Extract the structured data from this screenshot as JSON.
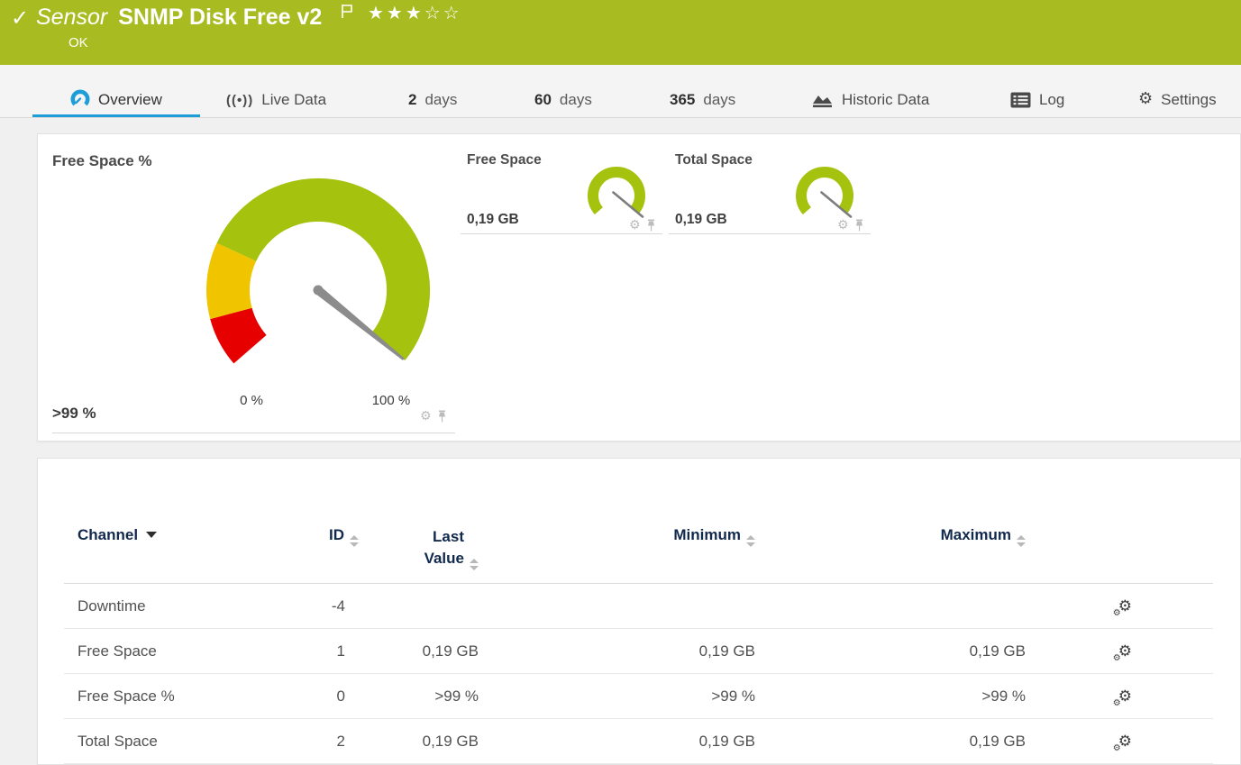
{
  "header": {
    "kind": "Sensor",
    "title": "SNMP Disk Free v2",
    "status": "OK",
    "stars_filled": "★★★",
    "stars_empty": "☆☆",
    "rating": "3 of 5",
    "bg_color": "#a8bc22"
  },
  "icons": {
    "check_glyph": "✓",
    "broadcast_glyph": "((•))",
    "gear_glyph": "⚙"
  },
  "tabs": {
    "overview": {
      "label": "Overview",
      "active": true
    },
    "live_data": {
      "label": "Live Data"
    },
    "days2": {
      "num": "2",
      "unit": "days"
    },
    "days60": {
      "num": "60",
      "unit": "days"
    },
    "days365": {
      "num": "365",
      "unit": "days"
    },
    "historic": {
      "label": "Historic Data"
    },
    "log": {
      "label": "Log"
    },
    "settings": {
      "label": "Settings"
    },
    "active_color": "#1d9ed9"
  },
  "gauges": {
    "primary": {
      "title": "Free Space %",
      "value": ">99 %",
      "scale_min": "0 %",
      "scale_max": "100 %",
      "percent": 99
    },
    "mini": [
      {
        "title": "Free Space",
        "value": "0,19 GB"
      },
      {
        "title": "Total Space",
        "value": "0,19 GB"
      }
    ],
    "colors": {
      "green": "#a4c20e",
      "yellow": "#f0c500",
      "red": "#e60000",
      "needle": "#8c8c8c"
    }
  },
  "channel_table": {
    "headers": {
      "channel": "Channel",
      "id": "ID",
      "last_value": "Last Value",
      "minimum": "Minimum",
      "maximum": "Maximum"
    },
    "rows": [
      {
        "channel": "Downtime",
        "id": "-4",
        "last": "",
        "min": "",
        "max": ""
      },
      {
        "channel": "Free Space",
        "id": "1",
        "last": "0,19 GB",
        "min": "0,19 GB",
        "max": "0,19 GB"
      },
      {
        "channel": "Free Space %",
        "id": "0",
        "last": ">99 %",
        "min": ">99 %",
        "max": ">99 %"
      },
      {
        "channel": "Total Space",
        "id": "2",
        "last": "0,19 GB",
        "min": "0,19 GB",
        "max": "0,19 GB"
      }
    ]
  }
}
